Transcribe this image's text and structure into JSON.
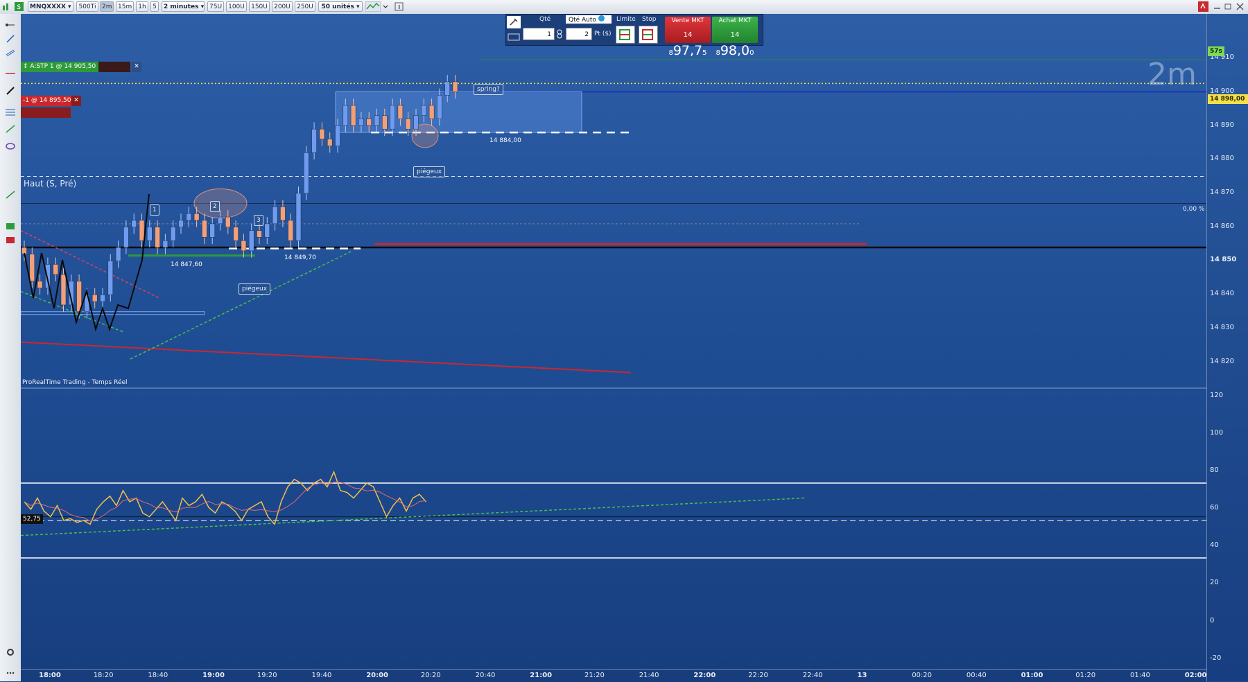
{
  "toolbar": {
    "instrument": "MNQXXXX",
    "timeframes": [
      "500Ti",
      "2m",
      "15m",
      "1h",
      "5"
    ],
    "selected_timeframe": "2m",
    "period_dropdown": "2 minutes",
    "unit_buttons": [
      "75U",
      "100U",
      "150U",
      "200U",
      "250U"
    ],
    "units_dropdown": "50 unités"
  },
  "order_panel": {
    "qty_label": "Qté",
    "qty_value": "1",
    "qty_auto_label": "Qté Auto",
    "pts_value": "2",
    "pts_unit": "Pt ($)",
    "limit_label": "Limite",
    "stop_label": "Stop",
    "sell": {
      "label": "Vente MKT",
      "prefix": "14 8",
      "price": "97,7",
      "suffix": "5"
    },
    "buy": {
      "label": "Achat MKT",
      "prefix": "14 8",
      "price": "98,0",
      "suffix": "0"
    }
  },
  "chart": {
    "watermark": "2m",
    "countdown": "57s",
    "current_price": "14 898,00",
    "source_label": "ProRealTime Trading - Temps Réel",
    "high_label": "Haut (S, Pré)",
    "order_stop_tag": "A:STP 1 @ 14 905,50",
    "order_limit_tag": "-1 @ 14 895,50",
    "fib_label": "0,00 %",
    "level_14884": "14 884,00",
    "level_14849": "14 849,70",
    "level_14847": "14 847,60",
    "annotations": {
      "spring": "spring?",
      "piegeux_top": "piégeux",
      "piegeux_bottom": "piégeux",
      "n1": "1",
      "n2": "2",
      "n3": "3"
    },
    "indicator_value": "52,75"
  },
  "price_axis": [
    "14 910",
    "14 900",
    "14 890",
    "14 880",
    "14 870",
    "14 860",
    "14 850",
    "14 840",
    "14 830",
    "14 820"
  ],
  "indicator_axis": [
    "120",
    "100",
    "80",
    "60",
    "40",
    "20",
    "0",
    "-20"
  ],
  "time_axis": [
    "18:00",
    "18:20",
    "18:40",
    "19:00",
    "19:20",
    "19:40",
    "20:00",
    "20:20",
    "20:40",
    "21:00",
    "21:20",
    "21:40",
    "22:00",
    "22:20",
    "22:40",
    "13",
    "00:20",
    "00:40",
    "01:00",
    "01:20",
    "01:40",
    "02:00"
  ],
  "time_axis_bold": [
    "18:00",
    "19:00",
    "20:00",
    "21:00",
    "22:00",
    "13",
    "01:00",
    "02:00"
  ],
  "colors": {
    "up": "#6f9cf0",
    "down": "#f2a07a",
    "price_tag": "#f5e04a",
    "sell": "#c9282d",
    "buy": "#2e9a3a"
  }
}
